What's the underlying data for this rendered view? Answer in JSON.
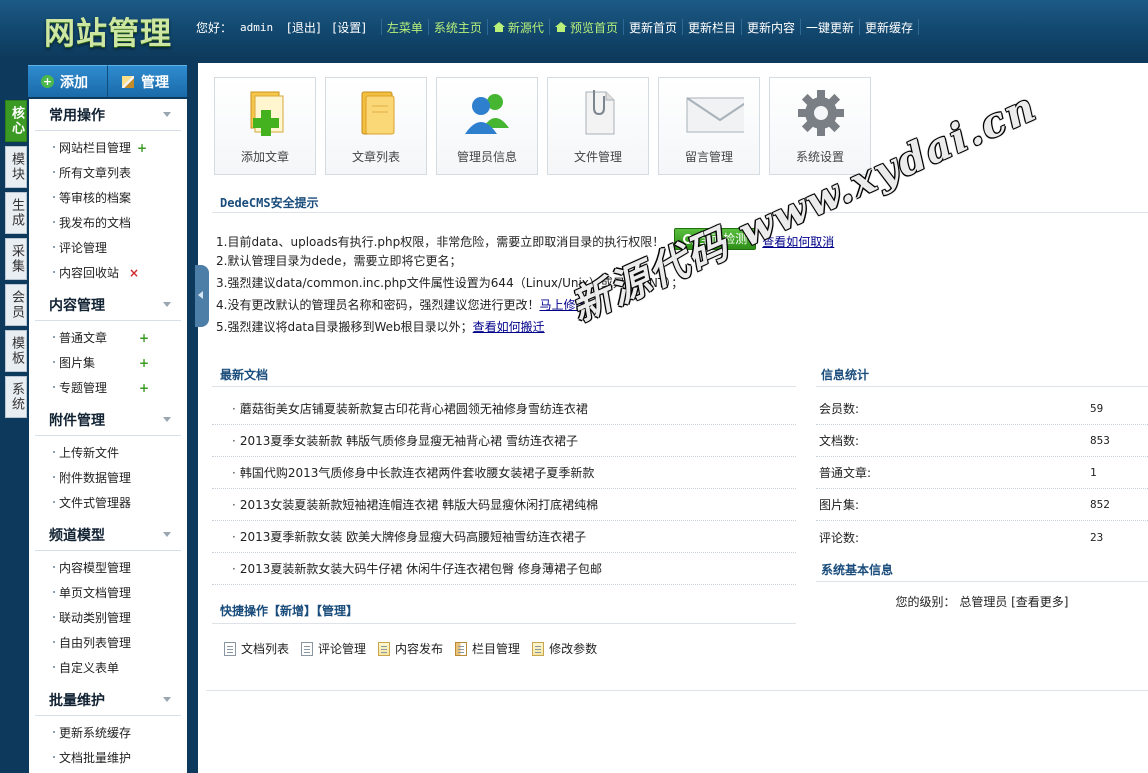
{
  "logo": "网站管理",
  "topbar": {
    "greeting": "您好：",
    "user": "admin",
    "logout": "[退出]",
    "settings": "[设置]",
    "left_menu": "左菜单",
    "sys_home": "系统主页",
    "new_source": "新源代",
    "preview": "预览首页",
    "links": [
      "更新首页",
      "更新栏目",
      "更新内容",
      "一键更新",
      "更新缓存"
    ]
  },
  "left": {
    "tab_add": "添加",
    "tab_manage": "管理",
    "vtabs": [
      "核心",
      "模块",
      "生成",
      "采集",
      "会员",
      "模板",
      "系统"
    ],
    "groups": [
      {
        "title": "常用操作",
        "items": [
          {
            "label": "网站栏目管理",
            "act": "+"
          },
          {
            "label": "所有文章列表",
            "act": ""
          },
          {
            "label": "等审核的档案",
            "act": ""
          },
          {
            "label": "我发布的文档",
            "act": ""
          },
          {
            "label": "评论管理",
            "act": ""
          },
          {
            "label": "内容回收站",
            "act": "×"
          }
        ]
      },
      {
        "title": "内容管理",
        "items": [
          {
            "label": "普通文章",
            "act": "+"
          },
          {
            "label": "图片集",
            "act": "+"
          },
          {
            "label": "专题管理",
            "act": "+"
          }
        ]
      },
      {
        "title": "附件管理",
        "items": [
          {
            "label": "上传新文件",
            "act": ""
          },
          {
            "label": "附件数据管理",
            "act": ""
          },
          {
            "label": "文件式管理器",
            "act": ""
          }
        ]
      },
      {
        "title": "频道模型",
        "items": [
          {
            "label": "内容模型管理",
            "act": ""
          },
          {
            "label": "单页文档管理",
            "act": ""
          },
          {
            "label": "联动类别管理",
            "act": ""
          },
          {
            "label": "自由列表管理",
            "act": ""
          },
          {
            "label": "自定义表单",
            "act": ""
          }
        ]
      },
      {
        "title": "批量维护",
        "items": [
          {
            "label": "更新系统缓存",
            "act": ""
          },
          {
            "label": "文档批量维护",
            "act": ""
          }
        ]
      }
    ]
  },
  "quick_icons": [
    {
      "label": "添加文章",
      "icon": "add-article-icon"
    },
    {
      "label": "文章列表",
      "icon": "folder-icon"
    },
    {
      "label": "管理员信息",
      "icon": "users-icon"
    },
    {
      "label": "文件管理",
      "icon": "file-clip-icon"
    },
    {
      "label": "留言管理",
      "icon": "envelope-icon"
    },
    {
      "label": "系统设置",
      "icon": "gear-icon"
    }
  ],
  "security": {
    "title": "DedeCMS安全提示",
    "line1": "1.目前data、uploads有执行.php权限，非常危险，需要立即取消目录的执行权限！",
    "check_btn": "全面检测",
    "line1_link": "查看如何取消",
    "line2": "2.默认管理目录为dede，需要立即将它更名；",
    "line3": "3.强烈建议data/common.inc.php文件属性设置为644（Linux/Unix）或只读（NT）；",
    "line4": "4.没有更改默认的管理员名称和密码，强烈建议您进行更改！",
    "line4_link": "马上修改",
    "line5": "5.强烈建议将data目录搬移到Web根目录以外；",
    "line5_link": "查看如何搬迁"
  },
  "latest": {
    "title": "最新文档",
    "items": [
      "蘑菇街美女店铺夏装新款复古印花背心裙圆领无袖修身雪纺连衣裙",
      "2013夏季女装新款 韩版气质修身显瘦无袖背心裙 雪纺连衣裙子",
      "韩国代购2013气质修身中长款连衣裙两件套收腰女装裙子夏季新款",
      "2013女装夏装新款短袖裙连帽连衣裙 韩版大码显瘦休闲打底裙纯棉",
      "2013夏季新款女装 欧美大牌修身显瘦大码高腰短袖雪纺连衣裙子",
      "2013夏装新款女装大码牛仔裙 休闲牛仔连衣裙包臀 修身薄裙子包邮"
    ]
  },
  "stats": {
    "title": "信息统计",
    "rows": [
      {
        "label": "会员数:",
        "value": "59"
      },
      {
        "label": "文档数:",
        "value": "853"
      },
      {
        "label": "普通文章:",
        "value": "1"
      },
      {
        "label": "图片集:",
        "value": "852"
      },
      {
        "label": "评论数:",
        "value": "23"
      }
    ]
  },
  "sysinfo": {
    "title": "系统基本信息",
    "level": "您的级别： 总管理员 [查看更多]"
  },
  "shortcuts": {
    "title": "快捷操作【新增】【管理】",
    "items": [
      "文档列表",
      "评论管理",
      "内容发布",
      "栏目管理",
      "修改参数"
    ]
  },
  "watermark": "新源代码 www.xydai.cn"
}
